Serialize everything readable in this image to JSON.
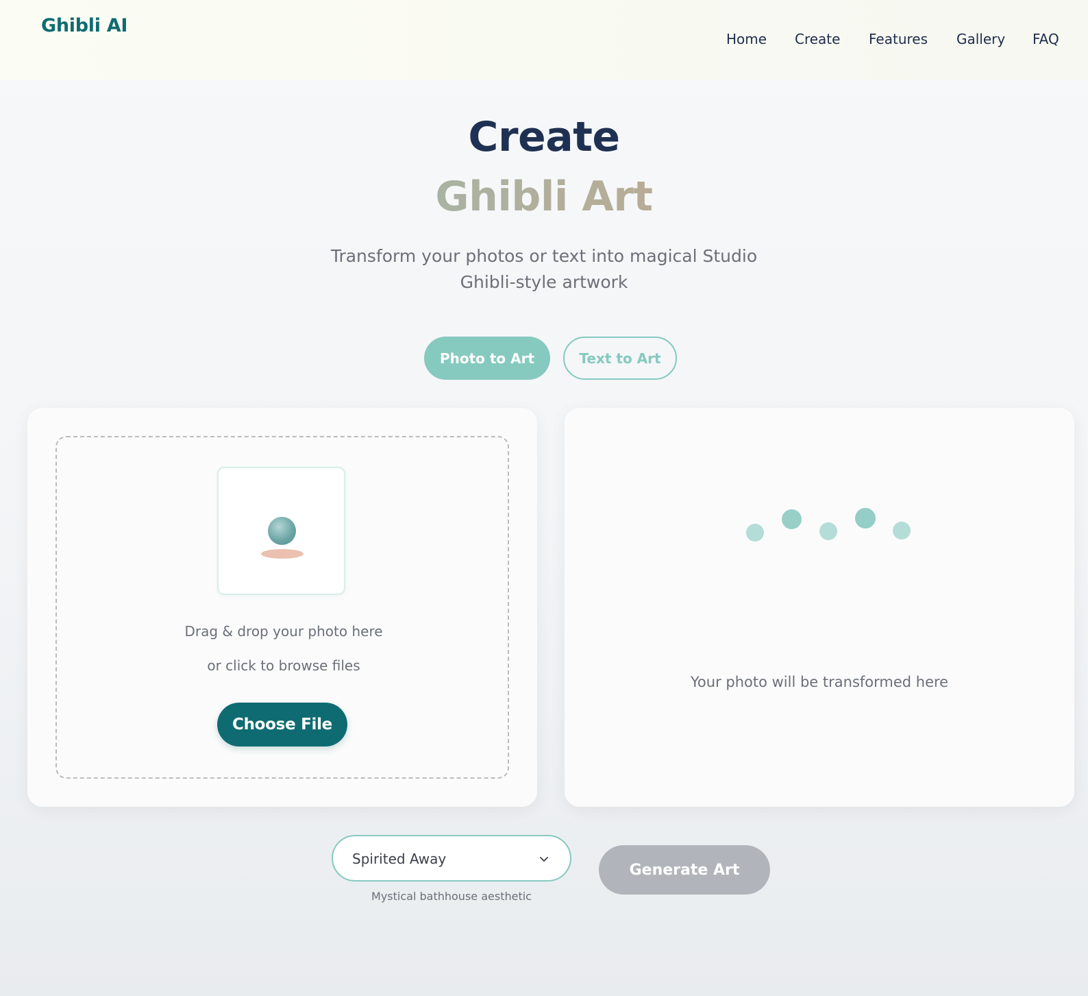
{
  "header": {
    "logo": "Ghibli AI",
    "nav": [
      "Home",
      "Create",
      "Features",
      "Gallery",
      "FAQ"
    ]
  },
  "hero": {
    "title": "Create",
    "subtitle": "Ghibli Art",
    "description": "Transform your photos or text into magical Studio Ghibli-style artwork"
  },
  "tabs": {
    "photo_label": "Photo to Art",
    "text_label": "Text to Art",
    "active": "Photo to Art"
  },
  "upload": {
    "drag_text": "Drag & drop your photo here",
    "browse_text": "or click to browse files",
    "choose_label": "Choose File"
  },
  "result": {
    "placeholder_text": "Your photo will be transformed here"
  },
  "style_select": {
    "value": "Spirited Away",
    "description": "Mystical bathhouse aesthetic"
  },
  "generate": {
    "label": "Generate Art",
    "enabled": false
  },
  "colors": {
    "brand": "#0f6b72",
    "accent": "#86c9bf",
    "navy": "#1f3152",
    "disabled": "#b1b5bb"
  }
}
